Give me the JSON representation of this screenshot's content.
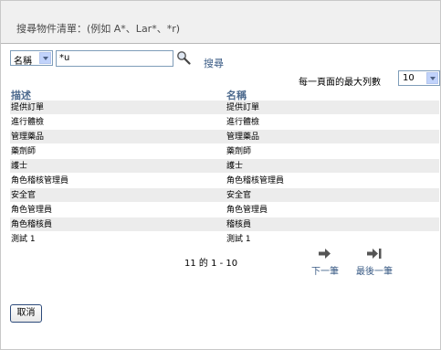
{
  "header": {
    "title": "搜尋物件清單：(例如 A*、Lar*、*r)"
  },
  "search": {
    "field_selected": "名稱",
    "query_value": "*u",
    "search_label": "搜尋"
  },
  "max_rows": {
    "label": "每一頁面的最大列數",
    "value": "10"
  },
  "table": {
    "columns": [
      "描述",
      "名稱"
    ],
    "rows": [
      [
        "提供訂單",
        "提供訂單"
      ],
      [
        "進行體檢",
        "進行體檢"
      ],
      [
        "管理藥品",
        "管理藥品"
      ],
      [
        "藥劑師",
        "藥劑師"
      ],
      [
        "護士",
        "護士"
      ],
      [
        "角色稽核管理員",
        "角色稽核管理員"
      ],
      [
        "安全官",
        "安全官"
      ],
      [
        "角色管理員",
        "角色管理員"
      ],
      [
        "角色稽核員",
        "稽核員"
      ],
      [
        "測試 1",
        "測試 1"
      ]
    ]
  },
  "pager": {
    "status": "11 的 1 - 10",
    "next_label": "下一筆",
    "last_label": "最後一筆"
  },
  "buttons": {
    "cancel_label": "取消"
  },
  "colors": {
    "link": "#3a5b85",
    "header_bg": "#f0f0f0",
    "row_alt": "#ececec"
  }
}
